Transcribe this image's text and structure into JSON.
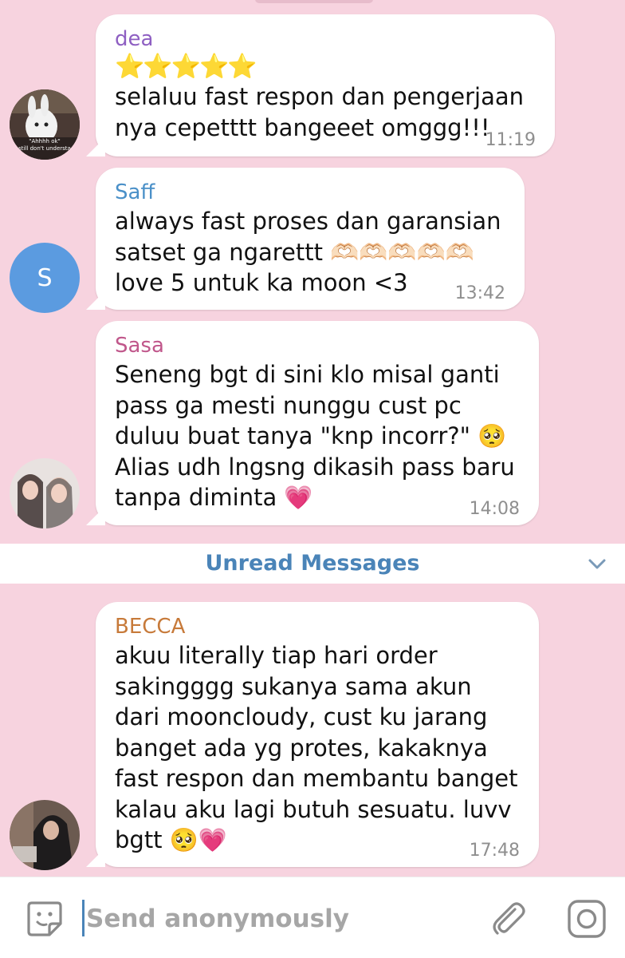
{
  "colors": {
    "background": "#f7d3df",
    "unread": "#4a84b8"
  },
  "messages": [
    {
      "sender": "dea",
      "sender_color": "#8e5fc2",
      "stars": "⭐⭐⭐⭐⭐",
      "text": "selaluu fast respon dan pengerjaan\nnya cepetttt bangeeet omggg!!!",
      "time": "11:19",
      "avatar": "bunny-photo",
      "avatar_caption_1": "\"Ahhhh ok\"",
      "avatar_caption_2": "still don't understa"
    },
    {
      "sender": "Saff",
      "sender_color": "#4a90c8",
      "text": "always fast proses dan garansian\nsatset ga ngarettt 🫶🏻🫶🏻🫶🏻🫶🏻🫶🏻\nlove 5 untuk ka moon <3",
      "time": "13:42",
      "avatar_letter": "S"
    },
    {
      "sender": "Sasa",
      "sender_color": "#c0578b",
      "text": "Seneng bgt di sini klo misal ganti\npass ga mesti nunggu cust pc\nduluu buat tanya \"knp incorr?\" 🥺\nAlias udh lngsng dikasih pass baru\ntanpa diminta 💗",
      "time": "14:08",
      "avatar": "two-girls-photo"
    },
    {
      "sender": "BECCA",
      "sender_color": "#c77a3a",
      "text": "akuu literally tiap hari order\nsakingggg sukanya sama akun\ndari mooncloudy, cust ku jarang\nbanget ada yg protes, kakaknya\nfast respon dan membantu banget\nkalau aku lagi butuh sesuatu. luvv\nbgtt 🥺💗",
      "time": "17:48",
      "avatar": "hooded-person-photo"
    }
  ],
  "unread_label": "Unread Messages",
  "input": {
    "placeholder": "Send anonymously"
  },
  "icons": {
    "sticker": "sticker-icon",
    "attach": "paperclip-icon",
    "instagram": "instagram-icon",
    "chevron": "chevron-down-icon"
  }
}
